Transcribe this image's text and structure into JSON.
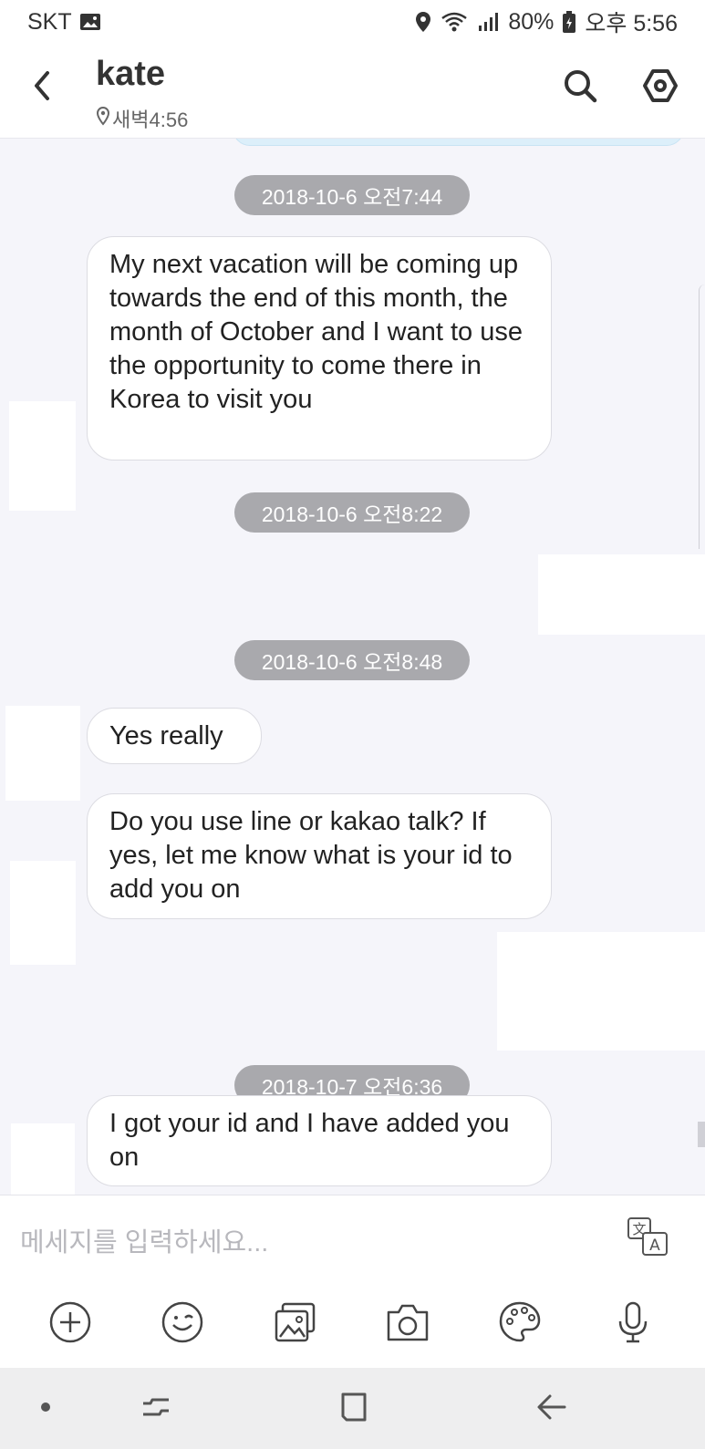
{
  "status_bar": {
    "carrier": "SKT",
    "battery": "80%",
    "time": "오후 5:56",
    "icons": [
      "image-icon",
      "location-icon",
      "wifi-icon",
      "signal-icon",
      "battery-icon"
    ]
  },
  "header": {
    "contact_name": "kate",
    "contact_local_time": "새벽4:56",
    "icons": [
      "back-arrow-icon",
      "location-pin-icon",
      "search-icon",
      "settings-icon"
    ]
  },
  "messages": [
    {
      "type": "timestamp",
      "text": "2018-10-6 오전7:44"
    },
    {
      "type": "received",
      "text": "My next vacation will be coming up towards the end of this month, the month of October and I want to use the opportunity to come there in Korea to visit you"
    },
    {
      "type": "timestamp",
      "text": "2018-10-6 오전8:22"
    },
    {
      "type": "timestamp",
      "text": "2018-10-6 오전8:48"
    },
    {
      "type": "received",
      "text": "Yes really"
    },
    {
      "type": "received",
      "text": "Do you use line or kakao talk? If yes, let me know what is your id to add you on"
    },
    {
      "type": "timestamp",
      "text": "2018-10-7 오전6:36"
    },
    {
      "type": "received",
      "text": "I got your id and I have added you on"
    }
  ],
  "composer": {
    "placeholder": "메세지를 입력하세요...",
    "value": "",
    "tools": [
      "add-icon",
      "emoticon-icon",
      "gallery-icon",
      "camera-icon",
      "palette-icon",
      "microphone-icon"
    ]
  },
  "colors": {
    "chat_background": "#f5f5fa",
    "timestamp_pill": "#a9a9ad",
    "bubble_received": "#ffffff"
  }
}
